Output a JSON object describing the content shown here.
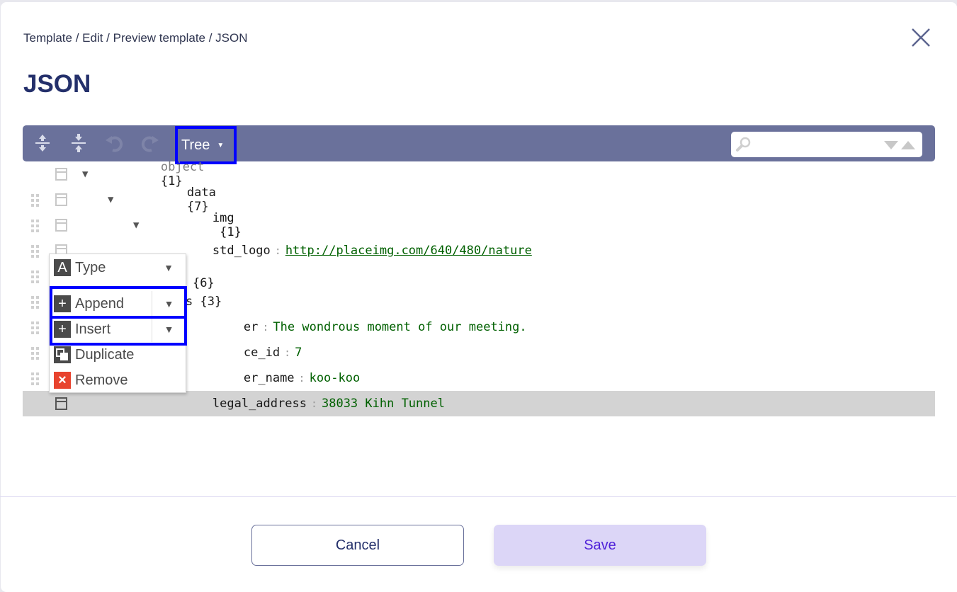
{
  "breadcrumb": "Template / Edit / Preview template / JSON",
  "title": "JSON",
  "toolbar": {
    "buttons": [
      "expand-all",
      "collapse-all",
      "undo",
      "redo"
    ],
    "mode_label": "Tree",
    "search_placeholder": ""
  },
  "tree": {
    "rows": [
      {
        "field": "object",
        "suffix": "{1}",
        "kind": "root"
      },
      {
        "field": "data",
        "suffix": "{7}",
        "kind": "object"
      },
      {
        "field": "img",
        "suffix": " {1}",
        "kind": "object"
      },
      {
        "field": "std_logo",
        "value": "http://placeimg.com/640/480/nature",
        "kind": "url"
      },
      {
        "field": "",
        "suffix": "{6}",
        "kind": "object"
      },
      {
        "field": "s",
        "suffix": "{3}",
        "kind": "object"
      },
      {
        "field": "er",
        "value": "The wondrous moment of our meeting.",
        "kind": "string"
      },
      {
        "field": "ce_id",
        "value": "7",
        "kind": "number"
      },
      {
        "field": "er_name",
        "value": "koo-koo",
        "kind": "string"
      },
      {
        "field": "legal_address",
        "value": "38033 Kihn Tunnel",
        "kind": "string"
      }
    ]
  },
  "context_menu": {
    "items": [
      {
        "label": "Type",
        "icon": "A"
      },
      {
        "label": "Append",
        "icon": "+"
      },
      {
        "label": "Insert",
        "icon": "+"
      },
      {
        "label": "Duplicate",
        "icon": "duplicate"
      },
      {
        "label": "Remove",
        "icon": "×"
      }
    ]
  },
  "footer": {
    "cancel_label": "Cancel",
    "save_label": "Save"
  }
}
